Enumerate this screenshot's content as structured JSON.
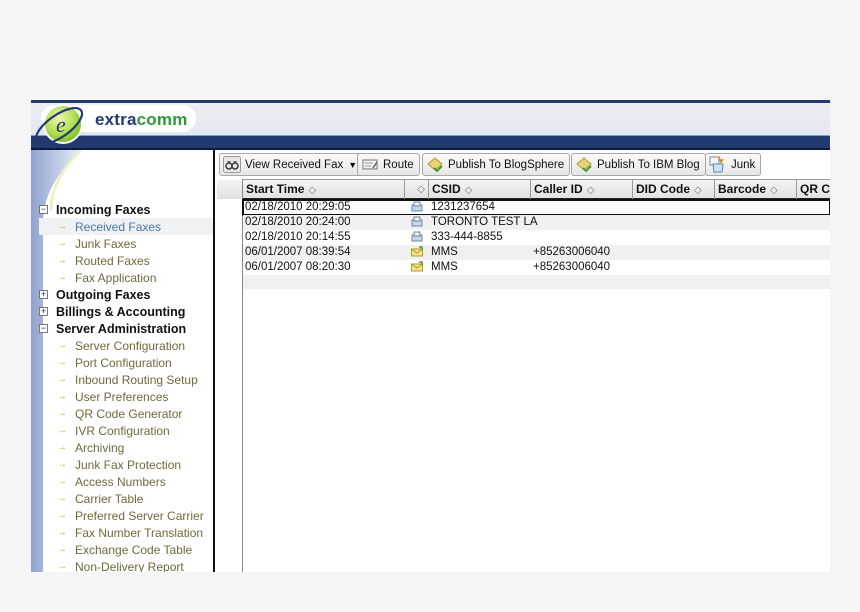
{
  "header": {
    "logo_text_a": "extra",
    "logo_text_b": "comm"
  },
  "sidebar": {
    "groups": [
      {
        "label": "Incoming Faxes",
        "expanded": true,
        "toggle": "−",
        "items": [
          {
            "label": "Received Faxes",
            "active": true
          },
          {
            "label": "Junk Faxes"
          },
          {
            "label": "Routed Faxes"
          },
          {
            "label": "Fax Application"
          }
        ]
      },
      {
        "label": "Outgoing Faxes",
        "expanded": false,
        "toggle": "+"
      },
      {
        "label": "Billings & Accounting",
        "expanded": false,
        "toggle": "+"
      },
      {
        "label": "Server Administration",
        "expanded": true,
        "toggle": "−",
        "items": [
          {
            "label": "Server Configuration"
          },
          {
            "label": "Port Configuration"
          },
          {
            "label": "Inbound Routing Setup"
          },
          {
            "label": "User Preferences"
          },
          {
            "label": "QR Code Generator"
          },
          {
            "label": "IVR Configuration"
          },
          {
            "label": "Archiving"
          },
          {
            "label": "Junk Fax Protection"
          },
          {
            "label": "Access Numbers"
          },
          {
            "label": "Carrier Table"
          },
          {
            "label": "Preferred Server Carrier"
          },
          {
            "label": "Fax Number Translation"
          },
          {
            "label": "Exchange Code Table"
          },
          {
            "label": "Non-Delivery Report"
          }
        ]
      }
    ],
    "item_arrow": "→"
  },
  "toolbar": {
    "view_received_fax": "View Received Fax",
    "route": "Route",
    "publish_blogsphere": "Publish To BlogSphere",
    "publish_ibm_blog": "Publish To IBM Blog",
    "junk": "Junk",
    "dropdown_glyph": "▼"
  },
  "grid": {
    "sort_glyph": "◇",
    "columns": [
      {
        "label": "Start Time"
      },
      {
        "label": ""
      },
      {
        "label": "CSID"
      },
      {
        "label": "Caller ID"
      },
      {
        "label": "DID Code"
      },
      {
        "label": "Barcode"
      },
      {
        "label": "QR Co"
      }
    ],
    "rows": [
      {
        "start_time": "02/18/2010 20:29:05",
        "type_icon": "fax-icon",
        "csid": "1231237654",
        "caller_id": "",
        "selected": true
      },
      {
        "start_time": "02/18/2010 20:24:00",
        "type_icon": "fax-icon",
        "csid": "TORONTO TEST LA",
        "caller_id": ""
      },
      {
        "start_time": "02/18/2010 20:14:55",
        "type_icon": "fax-icon",
        "csid": "333-444-8855",
        "caller_id": ""
      },
      {
        "start_time": "06/01/2007 08:39:54",
        "type_icon": "mms-envelope-icon",
        "csid": "MMS",
        "caller_id": "+85263006040"
      },
      {
        "start_time": "06/01/2007 08:20:30",
        "type_icon": "mms-envelope-icon",
        "csid": "MMS",
        "caller_id": "+85263006040"
      }
    ]
  },
  "colors": {
    "brand_navy": "#233a70",
    "brand_green": "#2e9a3a",
    "active_item": "#4a78a8",
    "item_text": "#6e6a3a",
    "arrow": "#d6a323"
  }
}
